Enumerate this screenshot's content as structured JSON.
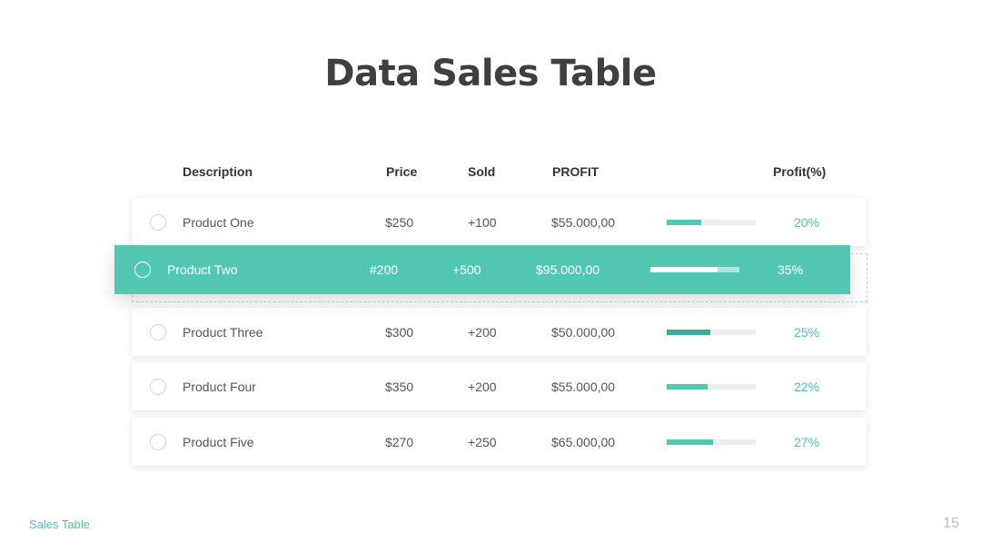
{
  "title": "Data Sales Table",
  "headers": {
    "description": "Description",
    "price": "Price",
    "sold": "Sold",
    "profit": "PROFIT",
    "profit_pct": "Profit(%)"
  },
  "colors": {
    "accent": "#52c8b3",
    "accent_dark": "#3aab97",
    "title": "#3f3f3f"
  },
  "rows": [
    {
      "name": "Product One",
      "price": "$250",
      "sold": "+100",
      "profit": "$55.000,00",
      "pct": "20%",
      "bar": 0.39
    },
    {
      "name": "Product Two",
      "price": "#200",
      "sold": "+500",
      "profit": "$95.000,00",
      "pct": "35%",
      "bar": 0.76
    },
    {
      "name": "Product Three",
      "price": "$300",
      "sold": "+200",
      "profit": "$50.000,00",
      "pct": "25%",
      "bar": 0.49
    },
    {
      "name": "Product Four",
      "price": "$350",
      "sold": "+200",
      "profit": "$55.000,00",
      "pct": "22%",
      "bar": 0.46
    },
    {
      "name": "Product Five",
      "price": "$270",
      "sold": "+250",
      "profit": "$65.000,00",
      "pct": "27%",
      "bar": 0.52
    }
  ],
  "footer": {
    "label": "Sales Table",
    "page": "15"
  }
}
